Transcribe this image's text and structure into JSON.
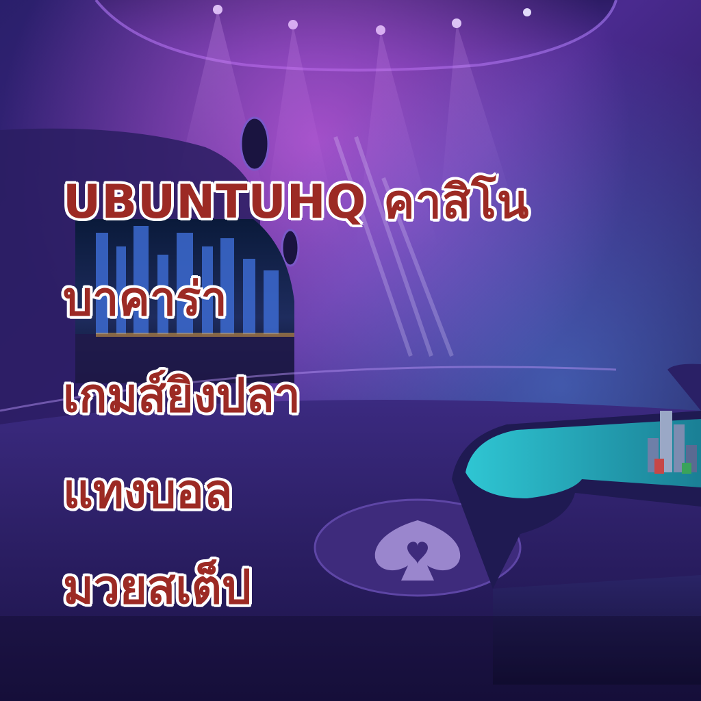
{
  "title_lines": [
    "UBUNTUHQ คาสิโน",
    "บาคาร่า",
    "เกมส์ยิงปลา",
    "แทงบอล",
    "มวยสเต็ป"
  ],
  "colors": {
    "text": "#9c2a24",
    "outline": "#ffffff",
    "background": "#1b1548",
    "accent_purple": "#8a3fd1",
    "accent_cyan": "#39d4e0"
  },
  "icons": [
    "spade-heart-emblem-icon",
    "poker-chips-icon",
    "spotlight-icon"
  ]
}
